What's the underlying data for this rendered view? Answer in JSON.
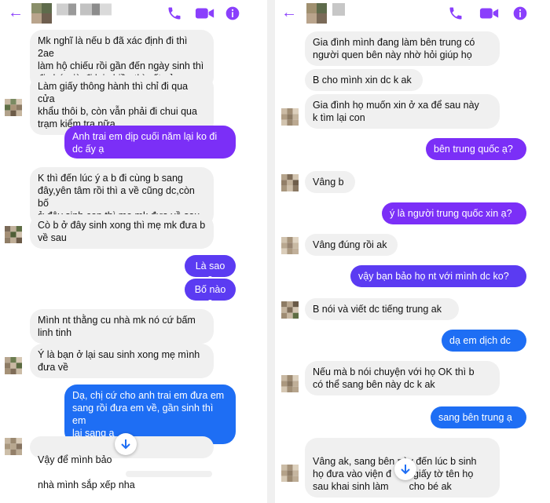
{
  "colors": {
    "accent": "#8a3ffc",
    "incoming_bg": "#f0f0f0",
    "outgoing_purple": "#7b2ff7",
    "outgoing_blue": "#1e6ef4",
    "outgoing_indigo": "#5b3bf2"
  },
  "left": {
    "header": {
      "back_icon": "arrow-left-icon",
      "call_icon": "phone-icon",
      "video_icon": "video-camera-icon",
      "info_icon": "info-icon"
    },
    "messages": [
      "Mk nghĩ là nếu b đã xác định đi thì 2ae\nlàm hộ chiếu rồi gần đến ngày sinh thì\nđi,chứ giờ đi lại nhiều thì vất vả ra",
      "Làm giấy thông hành thì chỉ đi qua cửa\nkhẩu thôi b, còn vẫn phải đi chui qua\ntrạm kiểm tra nữa",
      "Anh trai em dịp cuối năm lại ko đi\ndc ấy ạ",
      "K thì đến lúc ý a b đi cùng b sang\nđây,yên tâm rồi thì a về cũng dc,còn bố\nở đây sinh con thì mẹ mk đưa về sau",
      "Cò b ở đây sinh xong thì mẹ mk đưa b\nvề sau",
      "Là sao ạ",
      "Bố nào ạ",
      "Mình nt thằng cu nhà mk nó cứ bấm\nlinh tinh",
      "Ý là bạn ở lại sau sinh xong mẹ mình\nđưa về",
      "Dạ, chị cứ cho anh trai em đưa em\nsang rồi đưa em về, gần sinh thì em\nlại sang ạ",
      "Vậy để mình bảo",
      "nhà mình sắp xếp nha"
    ]
  },
  "right": {
    "header": {
      "back_icon": "arrow-left-icon",
      "call_icon": "phone-icon",
      "video_icon": "video-camera-icon",
      "info_icon": "info-icon"
    },
    "messages": [
      "Gia đình mình đang làm bên trung có\nngười quen bên này nhờ hỏi giúp họ",
      "B cho mình xin dc k ak",
      "Gia đình họ muốn xin ở xa để sau này\nk tìm lại con",
      "bên trung quốc ạ?",
      "Vâng b",
      "ý là người trung quốc xin ạ?",
      "Vâng đúng rồi ak",
      "vậy bạn bảo họ nt với mình dc ko?",
      "B nói và viết dc tiếng trung ak",
      "dạ em dịch dc",
      "Nếu mà b nói chuyện với họ OK thì b\ncó thể sang bên này dc k ak",
      "sang bên trung ạ",
      "Vâng ak, sang bên này đến lúc b sinh\nhọ đưa vào viện đ",
      "m giấy tờ tên họ\nsau khai sinh làm",
      "cho bé ak"
    ]
  }
}
